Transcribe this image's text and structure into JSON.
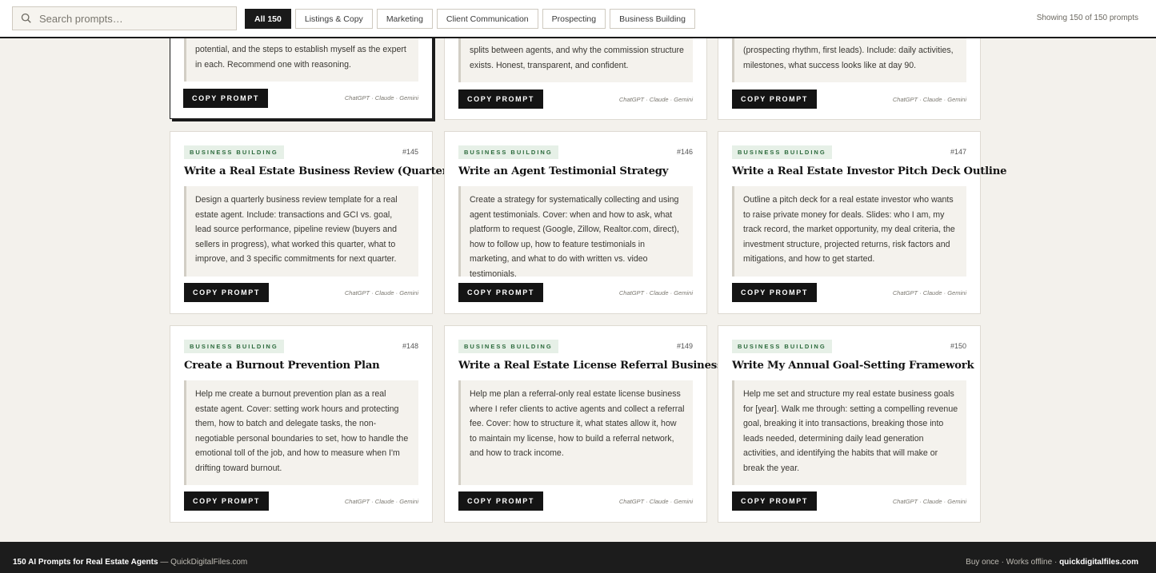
{
  "search": {
    "placeholder": "Search prompts…"
  },
  "filters": [
    {
      "label": "All 150",
      "active": true
    },
    {
      "label": "Listings & Copy"
    },
    {
      "label": "Marketing"
    },
    {
      "label": "Client Communication"
    },
    {
      "label": "Prospecting"
    },
    {
      "label": "Business Building"
    }
  ],
  "showing": "Showing 150 of 150 prompts",
  "copy_label": "COPY PROMPT",
  "models_label": "ChatGPT · Claude · Gemini",
  "top_cards": [
    {
      "body": "potential, and the steps to establish myself as the expert in each. Recommend one with reasoning."
    },
    {
      "body": "splits between agents, and why the commission structure exists. Honest, transparent, and confident."
    },
    {
      "body": "(prospecting rhythm, first leads). Include: daily activities, milestones, what success looks like at day 90."
    }
  ],
  "cards": [
    {
      "category": "BUSINESS BUILDING",
      "number": "#145",
      "title": "Write a Real Estate Business Review (Quarterly)",
      "body": "Design a quarterly business review template for a real estate agent. Include: transactions and GCI vs. goal, lead source performance, pipeline review (buyers and sellers in progress), what worked this quarter, what to improve, and 3 specific commitments for next quarter."
    },
    {
      "category": "BUSINESS BUILDING",
      "number": "#146",
      "title": "Write an Agent Testimonial Strategy",
      "body": "Create a strategy for systematically collecting and using agent testimonials. Cover: when and how to ask, what platform to request (Google, Zillow, Realtor.com, direct), how to follow up, how to feature testimonials in marketing, and what to do with written vs. video testimonials."
    },
    {
      "category": "BUSINESS BUILDING",
      "number": "#147",
      "title": "Write a Real Estate Investor Pitch Deck Outline",
      "body": "Outline a pitch deck for a real estate investor who wants to raise private money for deals. Slides: who I am, my track record, the market opportunity, my deal criteria, the investment structure, projected returns, risk factors and mitigations, and how to get started."
    },
    {
      "category": "BUSINESS BUILDING",
      "number": "#148",
      "title": "Create a Burnout Prevention Plan",
      "body": "Help me create a burnout prevention plan as a real estate agent. Cover: setting work hours and protecting them, how to batch and delegate tasks, the non-negotiable personal boundaries to set, how to handle the emotional toll of the job, and how to measure when I'm drifting toward burnout."
    },
    {
      "category": "BUSINESS BUILDING",
      "number": "#149",
      "title": "Write a Real Estate License Referral Business Plan",
      "body": "Help me plan a referral-only real estate license business where I refer clients to active agents and collect a referral fee. Cover: how to structure it, what states allow it, how to maintain my license, how to build a referral network, and how to track income."
    },
    {
      "category": "BUSINESS BUILDING",
      "number": "#150",
      "title": "Write My Annual Goal-Setting Framework",
      "body": "Help me set and structure my real estate business goals for [year]. Walk me through: setting a compelling revenue goal, breaking it into transactions, breaking those into leads needed, determining daily lead generation activities, and identifying the habits that will make or break the year."
    }
  ],
  "footer": {
    "title": "150 AI Prompts for Real Estate Agents",
    "separator": " — ",
    "site": "QuickDigitalFiles.com",
    "tagline": "Buy once · Works offline · ",
    "domain": "quickdigitalfiles.com"
  }
}
